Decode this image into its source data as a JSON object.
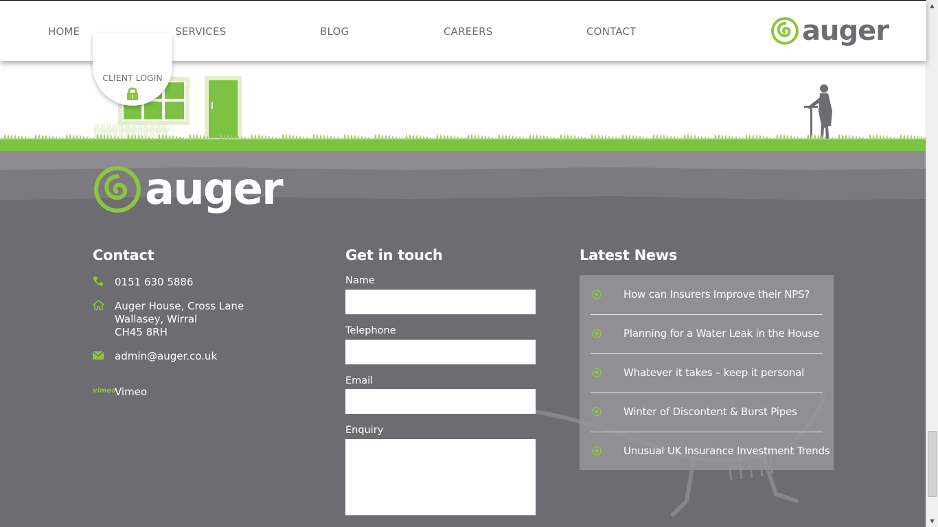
{
  "nav": {
    "items": [
      "HOME",
      "SERVICES",
      "BLOG",
      "CAREERS",
      "CONTACT"
    ],
    "logo_text": "auger"
  },
  "client_login": {
    "label": "CLIENT LOGIN"
  },
  "footer": {
    "logo_text": "auger",
    "contact": {
      "title": "Contact",
      "phone": "0151 630 5886",
      "address": [
        "Auger House, Cross Lane",
        "Wallasey, Wirral",
        "CH45 8RH"
      ],
      "email": "admin@auger.co.uk",
      "vimeo_icon_text": "vimeo",
      "vimeo": "Vimeo"
    },
    "get_in_touch": {
      "title": "Get in touch",
      "name_label": "Name",
      "telephone_label": "Telephone",
      "email_label": "Email",
      "enquiry_label": "Enquiry"
    },
    "news": {
      "title": "Latest News",
      "items": [
        "How can Insurers Improve their NPS?",
        "Planning for a Water Leak in the House",
        "Whatever it takes – keep it personal",
        "Winter of Discontent & Burst Pipes",
        "Unusual UK Insurance Investment Trends"
      ]
    }
  },
  "colors": {
    "brand_green": "#8cc63f",
    "grey_text": "#6d6c70",
    "footer_bg": "#6d6c70"
  }
}
